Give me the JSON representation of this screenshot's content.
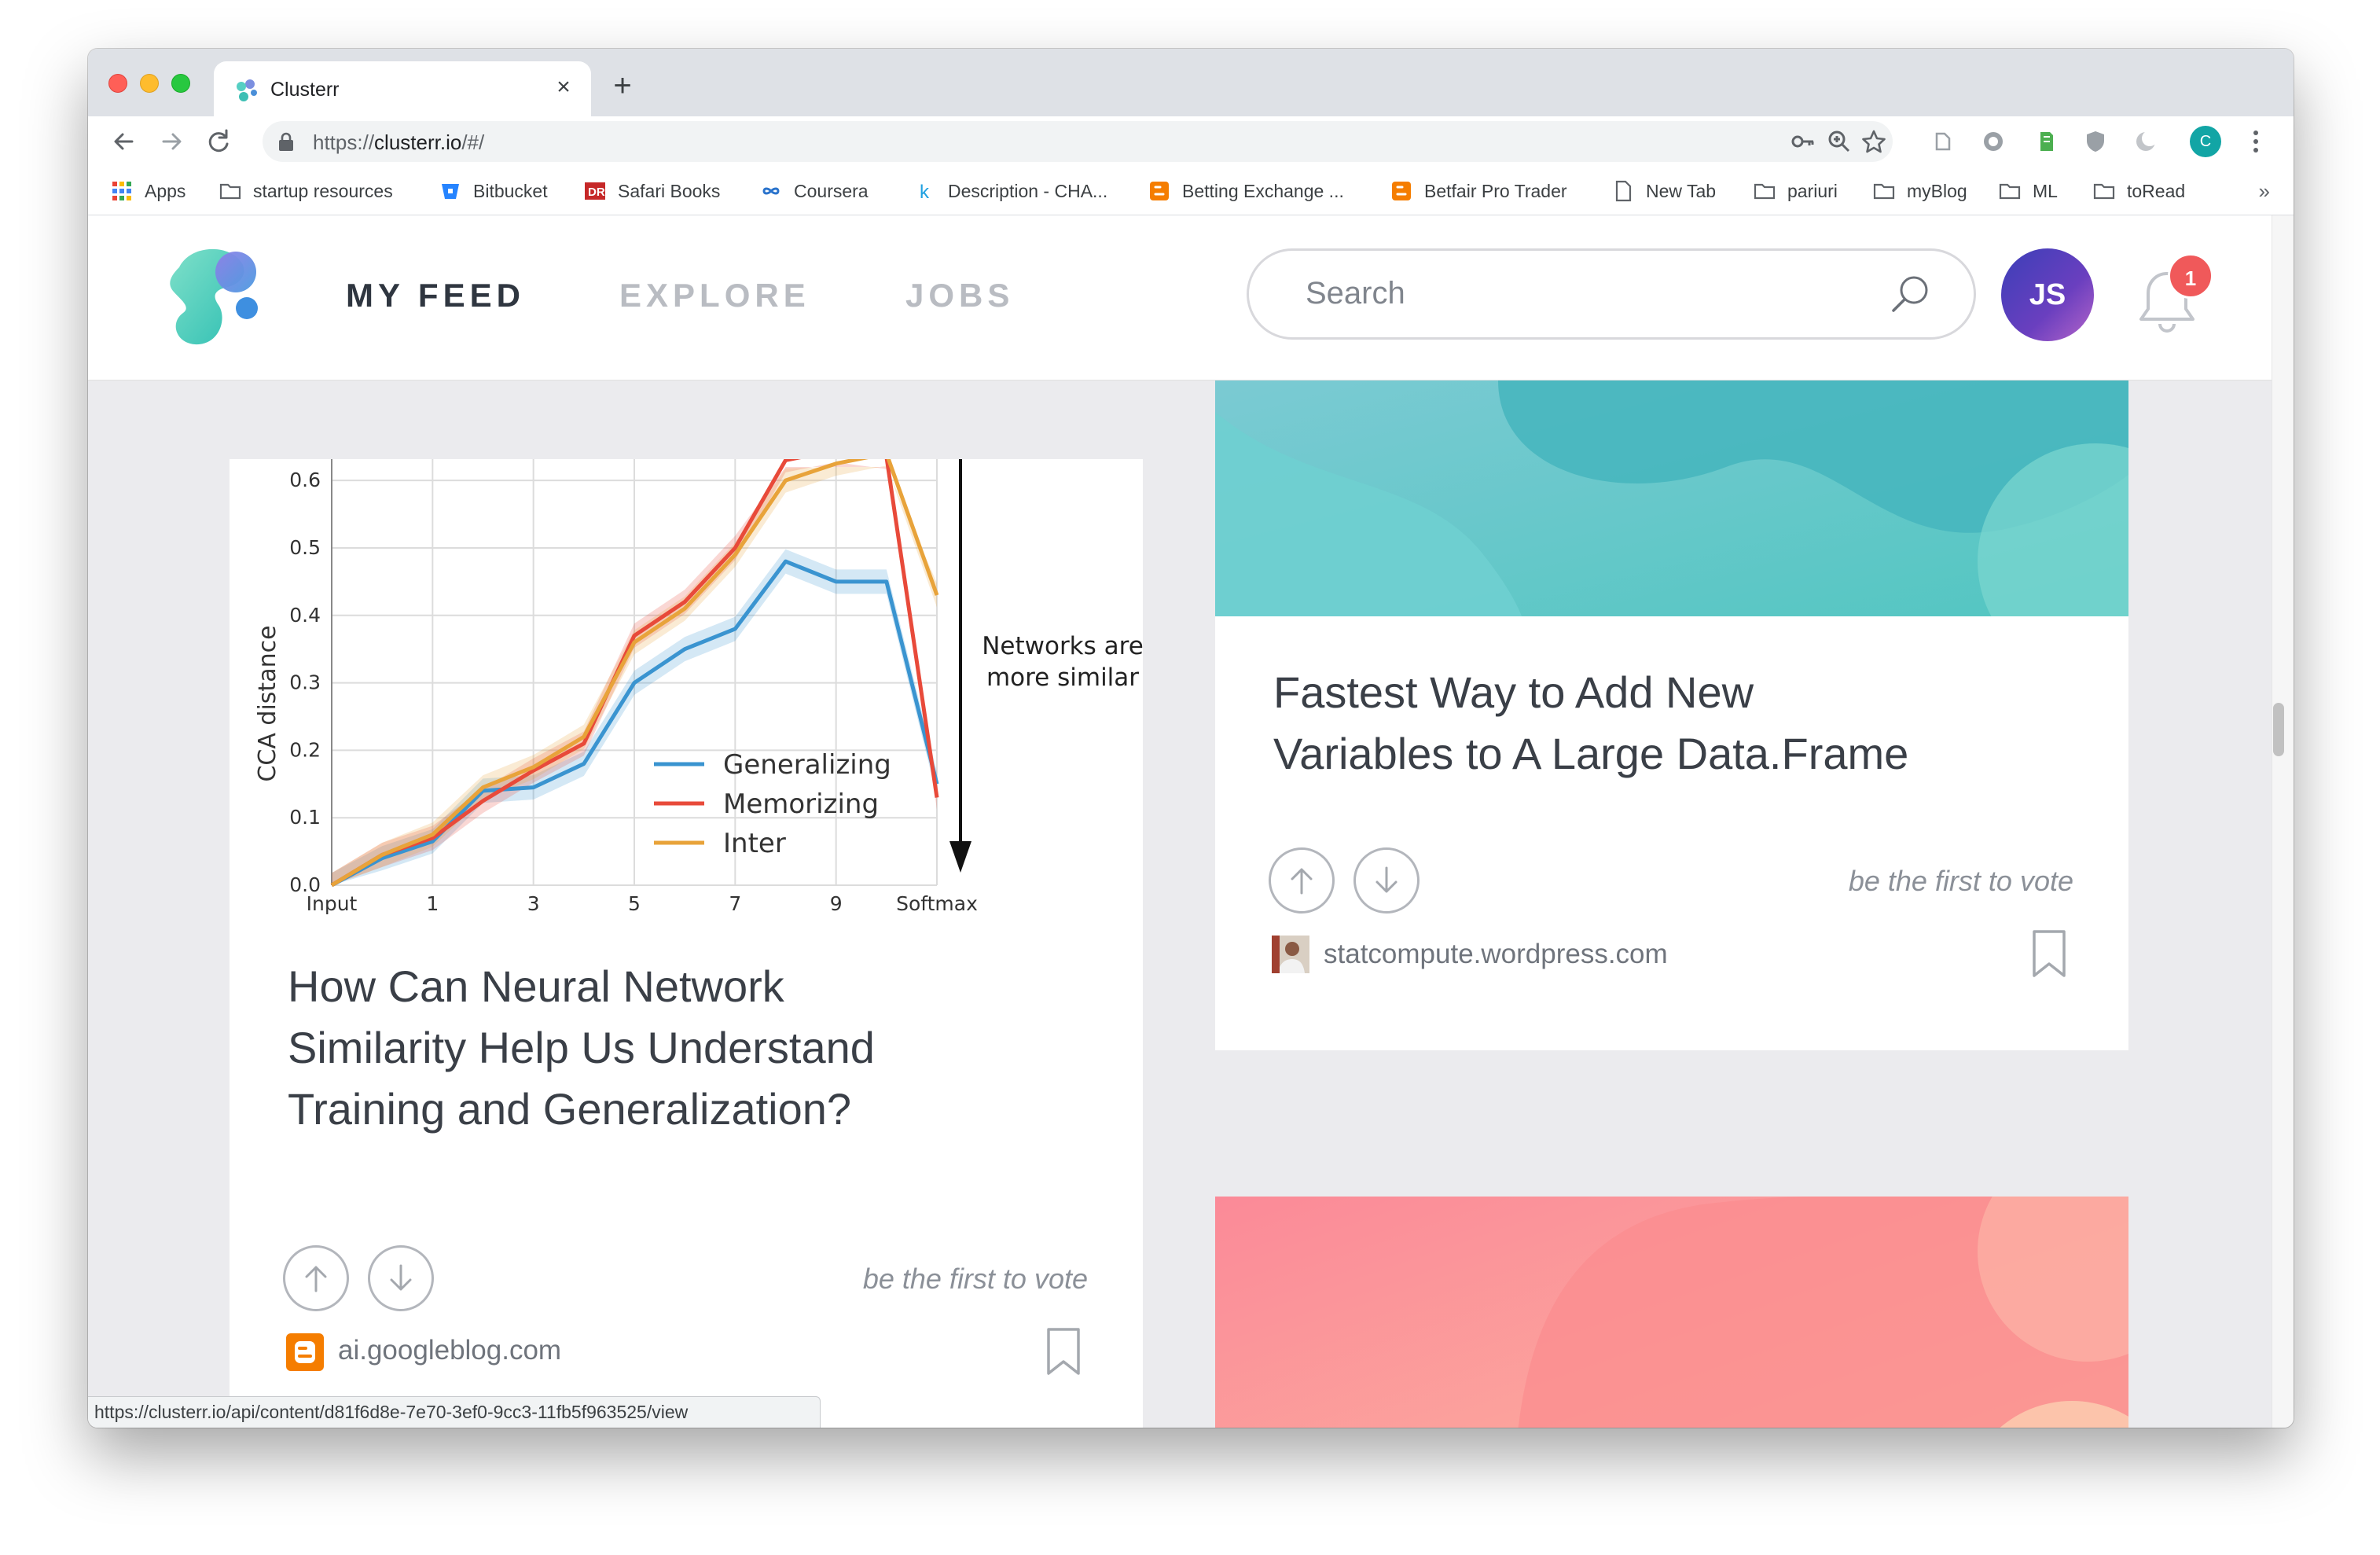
{
  "browser": {
    "tab_title": "Clusterr",
    "new_tab_label": "+",
    "close_label": "×",
    "url_scheme": "https://",
    "url_host": "clusterr.io",
    "url_path": "/#/",
    "profile_initial": "C",
    "bookmarks": [
      {
        "label": "Apps",
        "icon": "apps-grid-icon"
      },
      {
        "label": "startup resources",
        "icon": "folder-icon"
      },
      {
        "label": "Bitbucket",
        "icon": "bitbucket-icon"
      },
      {
        "label": "Safari Books",
        "icon": "safari-books-icon"
      },
      {
        "label": "Coursera",
        "icon": "coursera-icon"
      },
      {
        "label": "Description - CHA...",
        "icon": "k-icon"
      },
      {
        "label": "Betting Exchange ...",
        "icon": "blogger-icon"
      },
      {
        "label": "Betfair Pro Trader",
        "icon": "blogger-icon"
      },
      {
        "label": "New Tab",
        "icon": "page-icon"
      },
      {
        "label": "pariuri",
        "icon": "folder-icon"
      },
      {
        "label": "myBlog",
        "icon": "folder-icon"
      },
      {
        "label": "ML",
        "icon": "folder-icon"
      },
      {
        "label": "toRead",
        "icon": "folder-icon"
      }
    ],
    "bookmarks_more": "»",
    "status_url": "https://clusterr.io/api/content/d81f6d8e-7e70-3ef0-9cc3-11fb5f963525/view"
  },
  "header": {
    "nav": [
      {
        "label": "MY FEED",
        "active": true
      },
      {
        "label": "EXPLORE",
        "active": false
      },
      {
        "label": "JOBS",
        "active": false
      }
    ],
    "search_placeholder": "Search",
    "avatar_initials": "JS",
    "notification_count": "1"
  },
  "feed": {
    "cards": [
      {
        "title_lines": [
          "How Can Neural Network",
          "Similarity Help Us Understand",
          "Training and Generalization?"
        ],
        "vote_text": "be the first to vote",
        "source": "ai.googleblog.com",
        "source_icon": "blogger-icon"
      },
      {
        "title_lines": [
          "Fastest Way to Add New",
          "Variables to A Large Data.Frame"
        ],
        "vote_text": "be the first to vote",
        "source": "statcompute.wordpress.com",
        "source_icon": "author-photo-icon"
      }
    ]
  },
  "chart_data": {
    "type": "line",
    "title": "",
    "xlabel": "",
    "ylabel": "CCA distance",
    "x_tick_labels": [
      "Input",
      "1",
      "3",
      "5",
      "7",
      "9",
      "Softmax"
    ],
    "y_tick_labels": [
      "0.0",
      "0.1",
      "0.2",
      "0.3",
      "0.4",
      "0.5",
      "0.6"
    ],
    "ylim": [
      0,
      0.62
    ],
    "x": [
      0,
      1,
      2,
      3,
      4,
      5,
      6,
      7,
      8,
      9,
      10,
      11,
      12
    ],
    "series": [
      {
        "name": "Generalizing",
        "color": "#3a94d0",
        "values": [
          0.0,
          0.04,
          0.065,
          0.14,
          0.145,
          0.18,
          0.3,
          0.35,
          0.38,
          0.48,
          0.45,
          0.45,
          0.15
        ]
      },
      {
        "name": "Memorizing",
        "color": "#e84a3a",
        "values": [
          0.0,
          0.045,
          0.07,
          0.125,
          0.17,
          0.21,
          0.37,
          0.42,
          0.5,
          0.63,
          0.645,
          0.635,
          0.13
        ]
      },
      {
        "name": "Inter",
        "color": "#e8a33a",
        "values": [
          0.0,
          0.045,
          0.075,
          0.145,
          0.175,
          0.22,
          0.36,
          0.41,
          0.49,
          0.6,
          0.625,
          0.64,
          0.43
        ]
      }
    ],
    "legend_position": "bottom-right",
    "grid": true,
    "annotation": [
      "Networks are",
      "more similar"
    ]
  }
}
